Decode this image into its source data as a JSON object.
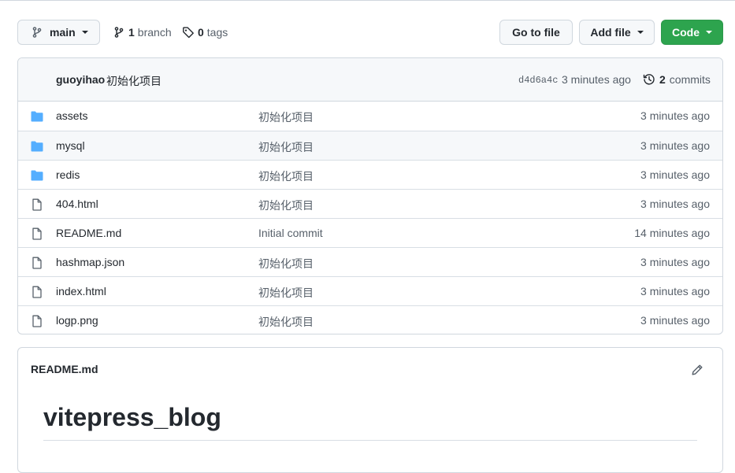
{
  "toolbar": {
    "branch_label": "main",
    "branch_count": "1",
    "branch_word": "branch",
    "tag_count": "0",
    "tag_word": "tags",
    "go_to_file": "Go to file",
    "add_file": "Add file",
    "code": "Code"
  },
  "commit": {
    "author": "guoyihao",
    "message": "初始化项目",
    "sha": "d4d6a4c",
    "time": "3 minutes ago",
    "commit_count": "2",
    "commit_word": "commits"
  },
  "files": [
    {
      "type": "folder",
      "icon": "folder-icon",
      "name": "assets",
      "message": "初始化项目",
      "time": "3 minutes ago"
    },
    {
      "type": "folder",
      "icon": "folder-icon",
      "name": "mysql",
      "message": "初始化项目",
      "time": "3 minutes ago"
    },
    {
      "type": "folder",
      "icon": "folder-icon",
      "name": "redis",
      "message": "初始化项目",
      "time": "3 minutes ago"
    },
    {
      "type": "file",
      "icon": "file-icon",
      "name": "404.html",
      "message": "初始化项目",
      "time": "3 minutes ago"
    },
    {
      "type": "file",
      "icon": "file-icon",
      "name": "README.md",
      "message": "Initial commit",
      "time": "14 minutes ago"
    },
    {
      "type": "file",
      "icon": "file-icon",
      "name": "hashmap.json",
      "message": "初始化项目",
      "time": "3 minutes ago"
    },
    {
      "type": "file",
      "icon": "file-icon",
      "name": "index.html",
      "message": "初始化项目",
      "time": "3 minutes ago"
    },
    {
      "type": "file",
      "icon": "file-icon",
      "name": "logp.png",
      "message": "初始化项目",
      "time": "3 minutes ago"
    }
  ],
  "readme": {
    "title": "README.md",
    "heading": "vitepress_blog"
  },
  "colors": {
    "folder": "#54aeff",
    "code_button": "#2da44e",
    "border": "#d0d7de",
    "muted_text": "#57606a"
  }
}
